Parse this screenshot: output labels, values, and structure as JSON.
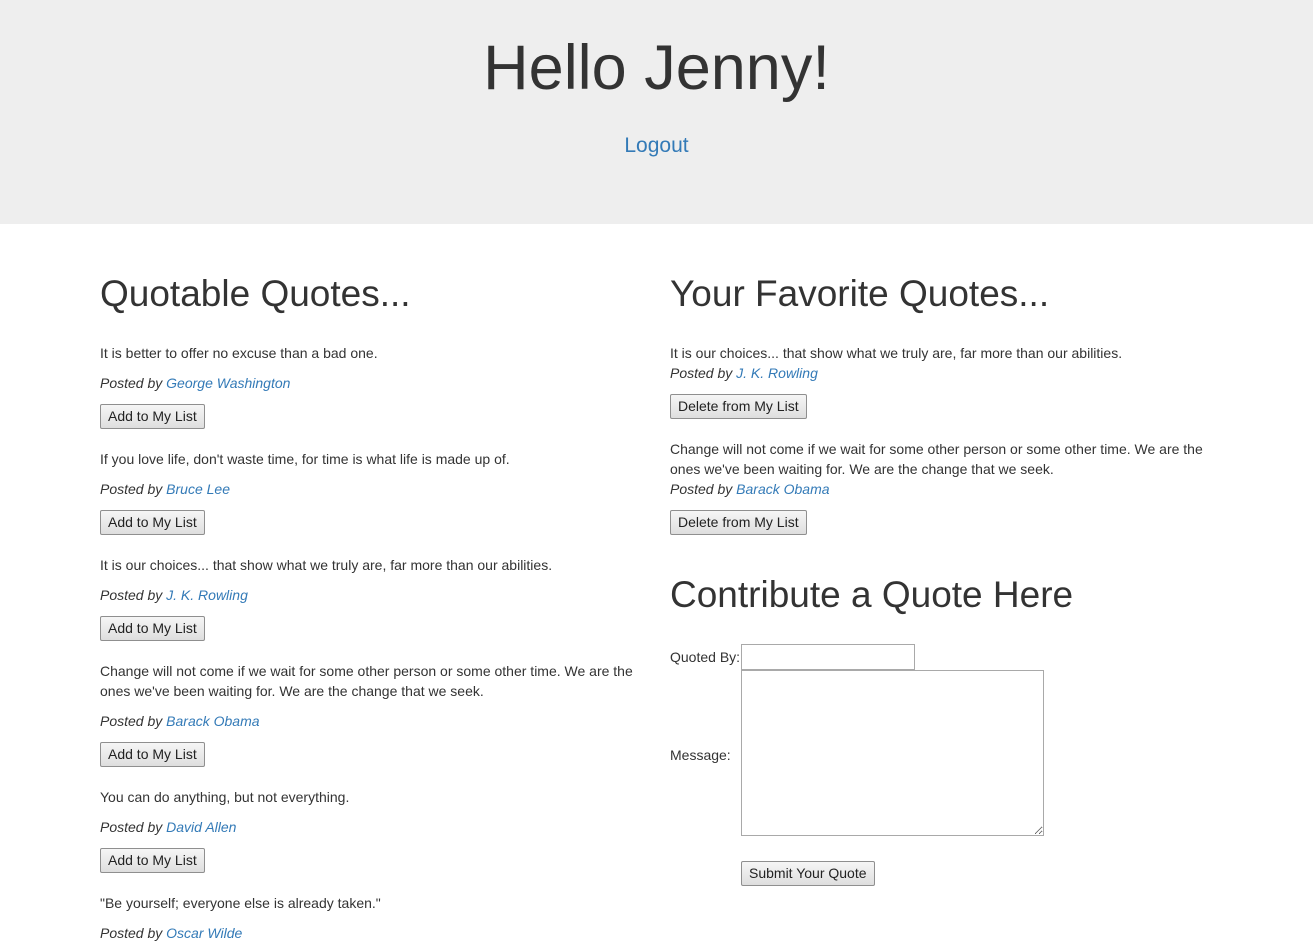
{
  "header": {
    "greeting": "Hello Jenny!",
    "logout_label": "Logout"
  },
  "quotable": {
    "title": "Quotable Quotes...",
    "posted_by_label": "Posted by",
    "button_label": "Add to My List",
    "items": [
      {
        "text": "It is better to offer no excuse than a bad one.",
        "author": "George Washington"
      },
      {
        "text": "If you love life, don't waste time, for time is what life is made up of.",
        "author": "Bruce Lee"
      },
      {
        "text": "It is our choices... that show what we truly are, far more than our abilities.",
        "author": "J. K. Rowling"
      },
      {
        "text": "Change will not come if we wait for some other person or some other time. We are the ones we've been waiting for. We are the change that we seek.",
        "author": "Barack Obama"
      },
      {
        "text": "You can do anything, but not everything.",
        "author": "David Allen"
      },
      {
        "text": "\"Be yourself; everyone else is already taken.\"",
        "author": "Oscar Wilde"
      }
    ]
  },
  "favorites": {
    "title": "Your Favorite Quotes...",
    "posted_by_label": "Posted by",
    "button_label": "Delete from My List",
    "items": [
      {
        "text": "It is our choices... that show what we truly are, far more than our abilities.",
        "author": "J. K. Rowling"
      },
      {
        "text": "Change will not come if we wait for some other person or some other time. We are the ones we've been waiting for. We are the change that we seek.",
        "author": "Barack Obama"
      }
    ]
  },
  "contribute": {
    "title": "Contribute a Quote Here",
    "quoted_by_label": "Quoted By:",
    "quoted_by_value": "",
    "message_label": "Message:",
    "message_value": "",
    "submit_label": "Submit Your Quote"
  }
}
